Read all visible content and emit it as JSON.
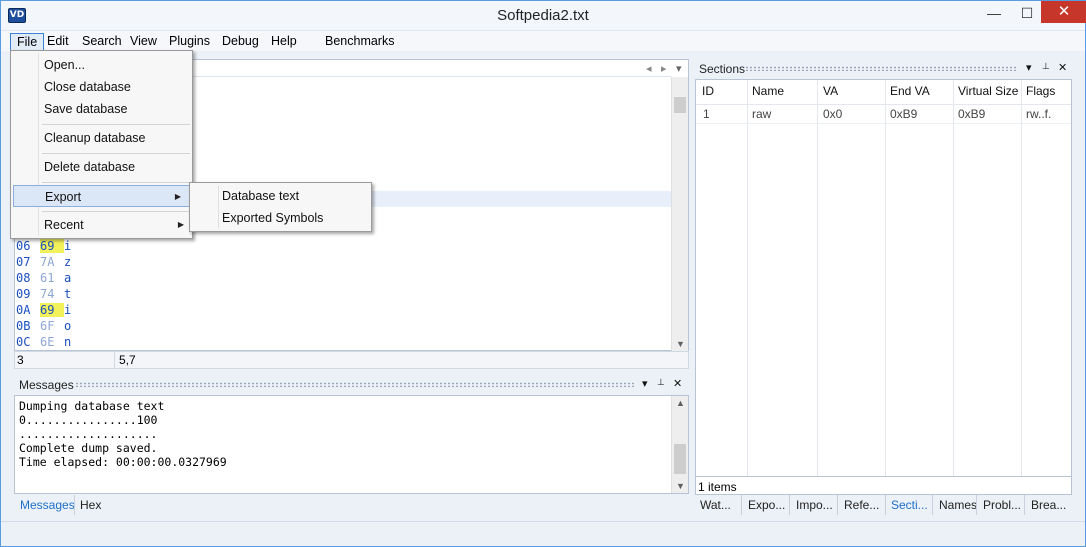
{
  "window": {
    "title": "Softpedia2.txt",
    "icon_text": "VD",
    "controls": {
      "minimize": "—",
      "maximize": "☐",
      "close": "✕"
    }
  },
  "menubar": [
    "File",
    "Edit",
    "Search",
    "View",
    "Plugins",
    "Debug",
    "Help",
    "Benchmarks"
  ],
  "file_menu": {
    "items": [
      "Open...",
      "Close database",
      "Save database",
      "Cleanup database",
      "Delete database",
      "Export",
      "Recent"
    ],
    "highlighted": "Export"
  },
  "export_submenu": [
    "Database text",
    "Exported Symbols"
  ],
  "hex_view": {
    "rows": [
      {
        "offset": "06",
        "byte": "69",
        "char": "i",
        "highlight": true
      },
      {
        "offset": "07",
        "byte": "7A",
        "char": "z",
        "highlight": false
      },
      {
        "offset": "08",
        "byte": "61",
        "char": "a",
        "highlight": false
      },
      {
        "offset": "09",
        "byte": "74",
        "char": "t",
        "highlight": false
      },
      {
        "offset": "0A",
        "byte": "69",
        "char": "i",
        "highlight": true
      },
      {
        "offset": "0B",
        "byte": "6F",
        "char": "o",
        "highlight": false
      },
      {
        "offset": "0C",
        "byte": "6E",
        "char": "n",
        "highlight": false
      }
    ],
    "status": {
      "left": "3",
      "right": "5,7"
    },
    "nav_icons": [
      "chevron-left-icon",
      "chevron-right-icon",
      "dropdown-icon"
    ]
  },
  "messages": {
    "title": "Messages",
    "lines": [
      "Dumping database text",
      "0................100",
      "....................",
      "Complete dump saved.",
      "Time elapsed: 00:00:00.0327969"
    ]
  },
  "left_tabs": [
    "Messages",
    "Hex"
  ],
  "sections": {
    "title": "Sections",
    "columns": [
      "ID",
      "Name",
      "VA",
      "End VA",
      "Virtual Size",
      "Flags"
    ],
    "rows": [
      [
        "1",
        "raw",
        "0x0",
        "0xB9",
        "0xB9",
        "rw..f."
      ]
    ],
    "footer": "1 items"
  },
  "right_tabs": [
    "Wat...",
    "Expo...",
    "Impo...",
    "Refe...",
    "Secti...",
    "Names",
    "Probl...",
    "Brea..."
  ],
  "right_tabs_active": "Secti...",
  "panel_buttons": {
    "dropdown": "▾",
    "pin": "📌",
    "close": "✕"
  },
  "colors": {
    "accent": "#1f6fc9",
    "close_button": "#c7362b",
    "hex_text": "#1a4fc0",
    "highlight": "#f3f15a"
  }
}
